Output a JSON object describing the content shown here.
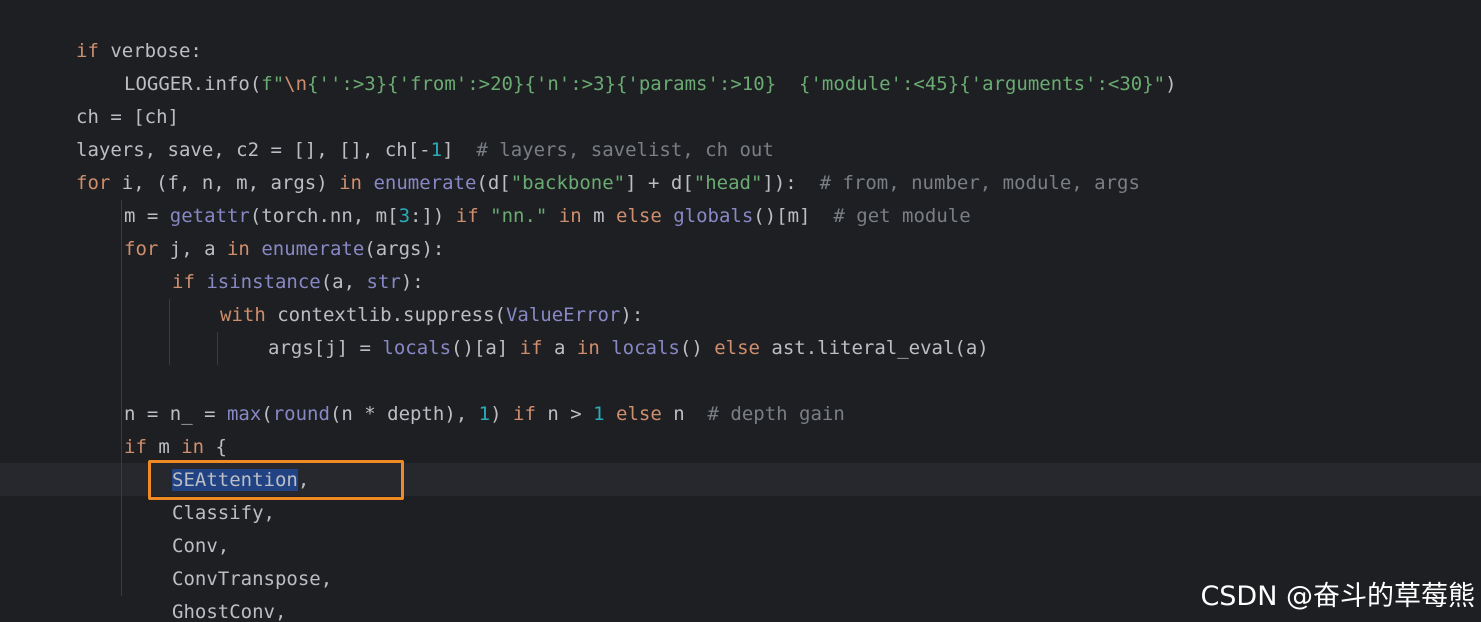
{
  "watermark": "CSDN @奋斗的草莓熊",
  "code_lines": [
    {
      "indent": 1,
      "tokens": [
        {
          "t": "kw",
          "v": "if"
        },
        {
          "t": "txt",
          "v": " verbose:"
        }
      ]
    },
    {
      "indent": 2,
      "tokens": [
        {
          "t": "txt",
          "v": "LOGGER.info("
        },
        {
          "t": "str",
          "v": "f\""
        },
        {
          "t": "esc",
          "v": "\\n"
        },
        {
          "t": "str",
          "v": "{"
        },
        {
          "t": "str",
          "v": "'':>3"
        },
        {
          "t": "str",
          "v": "}{"
        },
        {
          "t": "str",
          "v": "'from':>20"
        },
        {
          "t": "str",
          "v": "}{"
        },
        {
          "t": "str",
          "v": "'n':>3"
        },
        {
          "t": "str",
          "v": "}{"
        },
        {
          "t": "str",
          "v": "'params':>10"
        },
        {
          "t": "str",
          "v": "}  {"
        },
        {
          "t": "str",
          "v": "'module':<45"
        },
        {
          "t": "str",
          "v": "}{"
        },
        {
          "t": "str",
          "v": "'arguments':<30"
        },
        {
          "t": "str",
          "v": "}\""
        },
        {
          "t": "txt",
          "v": ")"
        }
      ]
    },
    {
      "indent": 1,
      "tokens": [
        {
          "t": "txt",
          "v": "ch = [ch]"
        }
      ]
    },
    {
      "indent": 1,
      "tokens": [
        {
          "t": "txt",
          "v": "layers, save, c2 = [], [], ch[-"
        },
        {
          "t": "num",
          "v": "1"
        },
        {
          "t": "txt",
          "v": "]  "
        },
        {
          "t": "cmt",
          "v": "# layers, savelist, ch out"
        }
      ]
    },
    {
      "indent": 1,
      "tokens": [
        {
          "t": "kw",
          "v": "for"
        },
        {
          "t": "txt",
          "v": " i, (f, n, m, args) "
        },
        {
          "t": "kw",
          "v": "in"
        },
        {
          "t": "txt",
          "v": " "
        },
        {
          "t": "bi",
          "v": "enumerate"
        },
        {
          "t": "txt",
          "v": "(d["
        },
        {
          "t": "str",
          "v": "\"backbone\""
        },
        {
          "t": "txt",
          "v": "] + d["
        },
        {
          "t": "str",
          "v": "\"head\""
        },
        {
          "t": "txt",
          "v": "]):  "
        },
        {
          "t": "cmt",
          "v": "# from, number, module, args"
        }
      ]
    },
    {
      "indent": 2,
      "tokens": [
        {
          "t": "txt",
          "v": "m = "
        },
        {
          "t": "bi",
          "v": "getattr"
        },
        {
          "t": "txt",
          "v": "(torch.nn, m["
        },
        {
          "t": "num",
          "v": "3"
        },
        {
          "t": "txt",
          "v": ":]) "
        },
        {
          "t": "kw",
          "v": "if"
        },
        {
          "t": "txt",
          "v": " "
        },
        {
          "t": "str",
          "v": "\"nn.\""
        },
        {
          "t": "txt",
          "v": " "
        },
        {
          "t": "kw",
          "v": "in"
        },
        {
          "t": "txt",
          "v": " m "
        },
        {
          "t": "kw",
          "v": "else"
        },
        {
          "t": "txt",
          "v": " "
        },
        {
          "t": "bi",
          "v": "globals"
        },
        {
          "t": "txt",
          "v": "()[m]  "
        },
        {
          "t": "cmt",
          "v": "# get module"
        }
      ]
    },
    {
      "indent": 2,
      "tokens": [
        {
          "t": "kw",
          "v": "for"
        },
        {
          "t": "txt",
          "v": " j, a "
        },
        {
          "t": "kw",
          "v": "in"
        },
        {
          "t": "txt",
          "v": " "
        },
        {
          "t": "bi",
          "v": "enumerate"
        },
        {
          "t": "txt",
          "v": "(args):"
        }
      ]
    },
    {
      "indent": 3,
      "tokens": [
        {
          "t": "kw",
          "v": "if"
        },
        {
          "t": "txt",
          "v": " "
        },
        {
          "t": "bi",
          "v": "isinstance"
        },
        {
          "t": "txt",
          "v": "(a, "
        },
        {
          "t": "cls",
          "v": "str"
        },
        {
          "t": "txt",
          "v": "):"
        }
      ]
    },
    {
      "indent": 4,
      "tokens": [
        {
          "t": "kw",
          "v": "with"
        },
        {
          "t": "txt",
          "v": " contextlib.suppress("
        },
        {
          "t": "cls",
          "v": "ValueError"
        },
        {
          "t": "txt",
          "v": "):"
        }
      ]
    },
    {
      "indent": 5,
      "tokens": [
        {
          "t": "txt",
          "v": "args[j] = "
        },
        {
          "t": "bi",
          "v": "locals"
        },
        {
          "t": "txt",
          "v": "()[a] "
        },
        {
          "t": "kw",
          "v": "if"
        },
        {
          "t": "txt",
          "v": " a "
        },
        {
          "t": "kw",
          "v": "in"
        },
        {
          "t": "txt",
          "v": " "
        },
        {
          "t": "bi",
          "v": "locals"
        },
        {
          "t": "txt",
          "v": "() "
        },
        {
          "t": "kw",
          "v": "else"
        },
        {
          "t": "txt",
          "v": " ast.literal_eval(a)"
        }
      ]
    },
    {
      "indent": 0,
      "tokens": []
    },
    {
      "indent": 2,
      "tokens": [
        {
          "t": "txt",
          "v": "n = n_ = "
        },
        {
          "t": "bi",
          "v": "max"
        },
        {
          "t": "txt",
          "v": "("
        },
        {
          "t": "bi",
          "v": "round"
        },
        {
          "t": "txt",
          "v": "(n * depth), "
        },
        {
          "t": "num",
          "v": "1"
        },
        {
          "t": "txt",
          "v": ") "
        },
        {
          "t": "kw",
          "v": "if"
        },
        {
          "t": "txt",
          "v": " n > "
        },
        {
          "t": "num",
          "v": "1"
        },
        {
          "t": "txt",
          "v": " "
        },
        {
          "t": "kw",
          "v": "else"
        },
        {
          "t": "txt",
          "v": " n  "
        },
        {
          "t": "cmt",
          "v": "# depth gain"
        }
      ]
    },
    {
      "indent": 2,
      "tokens": [
        {
          "t": "kw",
          "v": "if"
        },
        {
          "t": "txt",
          "v": " m "
        },
        {
          "t": "kw",
          "v": "in"
        },
        {
          "t": "txt",
          "v": " {"
        }
      ]
    },
    {
      "indent": 3,
      "tokens": [
        {
          "t": "sel",
          "v": "SEAttention"
        },
        {
          "t": "txt",
          "v": ","
        }
      ]
    },
    {
      "indent": 3,
      "tokens": [
        {
          "t": "txt",
          "v": "Classify,"
        }
      ]
    },
    {
      "indent": 3,
      "tokens": [
        {
          "t": "txt",
          "v": "Conv,"
        }
      ]
    },
    {
      "indent": 3,
      "tokens": [
        {
          "t": "txt",
          "v": "ConvTranspose,"
        }
      ]
    },
    {
      "indent": 3,
      "tokens": [
        {
          "t": "txt",
          "v": "GhostConv,"
        }
      ]
    }
  ]
}
